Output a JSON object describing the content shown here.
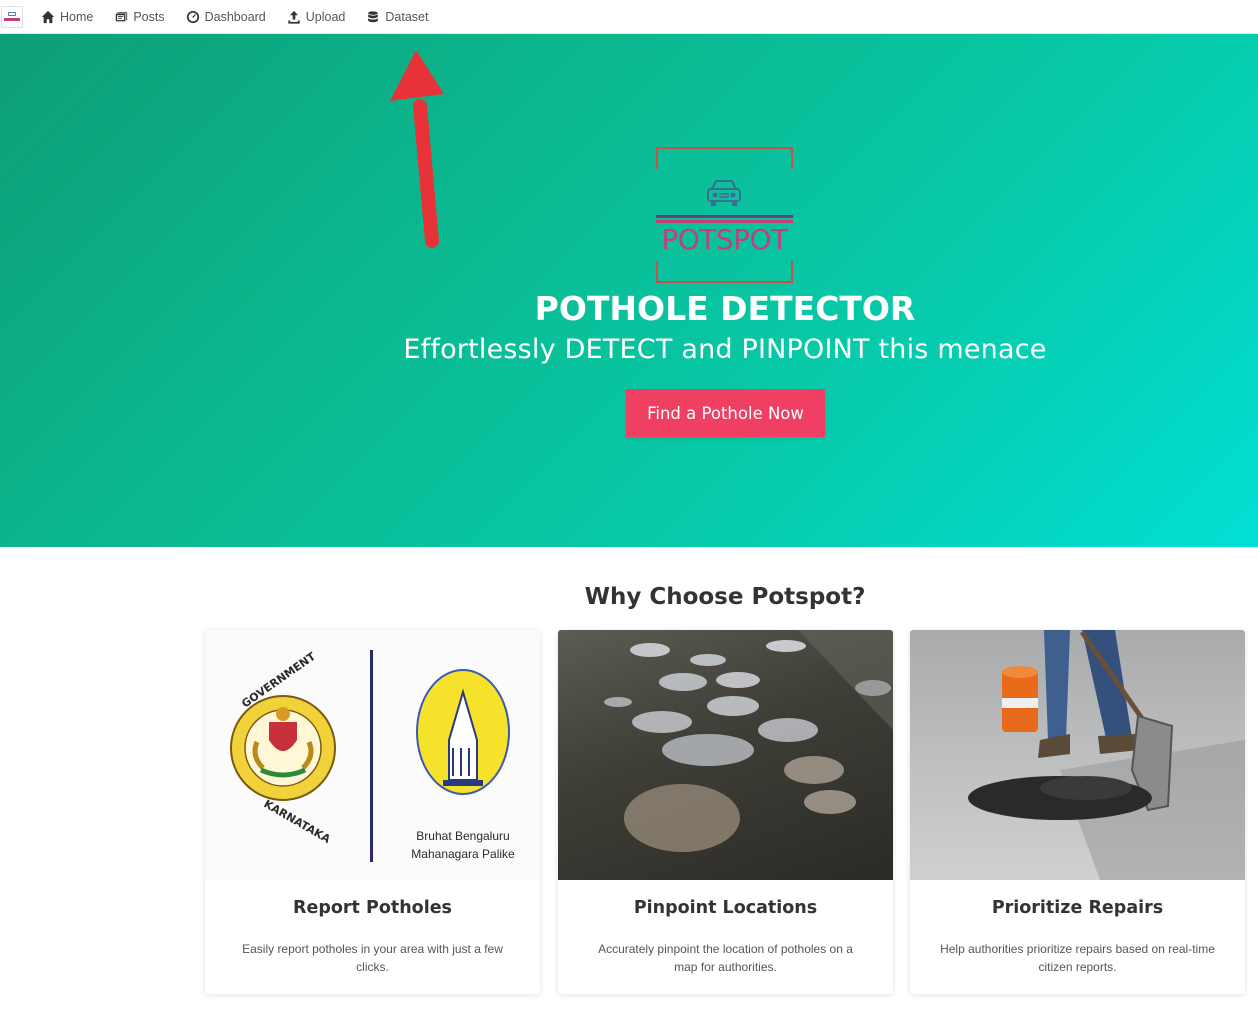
{
  "nav": {
    "items": [
      {
        "label": "Home",
        "icon": "home-icon"
      },
      {
        "label": "Posts",
        "icon": "posts-icon"
      },
      {
        "label": "Dashboard",
        "icon": "dashboard-icon"
      },
      {
        "label": "Upload",
        "icon": "upload-icon"
      },
      {
        "label": "Dataset",
        "icon": "database-icon"
      }
    ]
  },
  "hero": {
    "brand": "POTSPOT",
    "title": "POTHOLE DETECTOR",
    "subtitle": "Effortlessly DETECT and PINPOINT this menace",
    "cta": "Find a Pothole Now"
  },
  "features": {
    "title": "Why Choose Potspot?",
    "cards": [
      {
        "title": "Report Potholes",
        "desc": "Easily report potholes in your area with just a few clicks.",
        "logo_left": "GOVERNMENT OF KARNATAKA",
        "logo_right_line1": "Bruhat Bengaluru",
        "logo_right_line2": "Mahanagara Palike"
      },
      {
        "title": "Pinpoint Locations",
        "desc": "Accurately pinpoint the location of potholes on a map for authorities."
      },
      {
        "title": "Prioritize Repairs",
        "desc": "Help authorities prioritize repairs based on real-time citizen reports."
      }
    ]
  },
  "colors": {
    "accent": "#ef3f63",
    "hero_start": "#0e9e76",
    "hero_end": "#02dfd4",
    "brand": "#c0407a"
  }
}
